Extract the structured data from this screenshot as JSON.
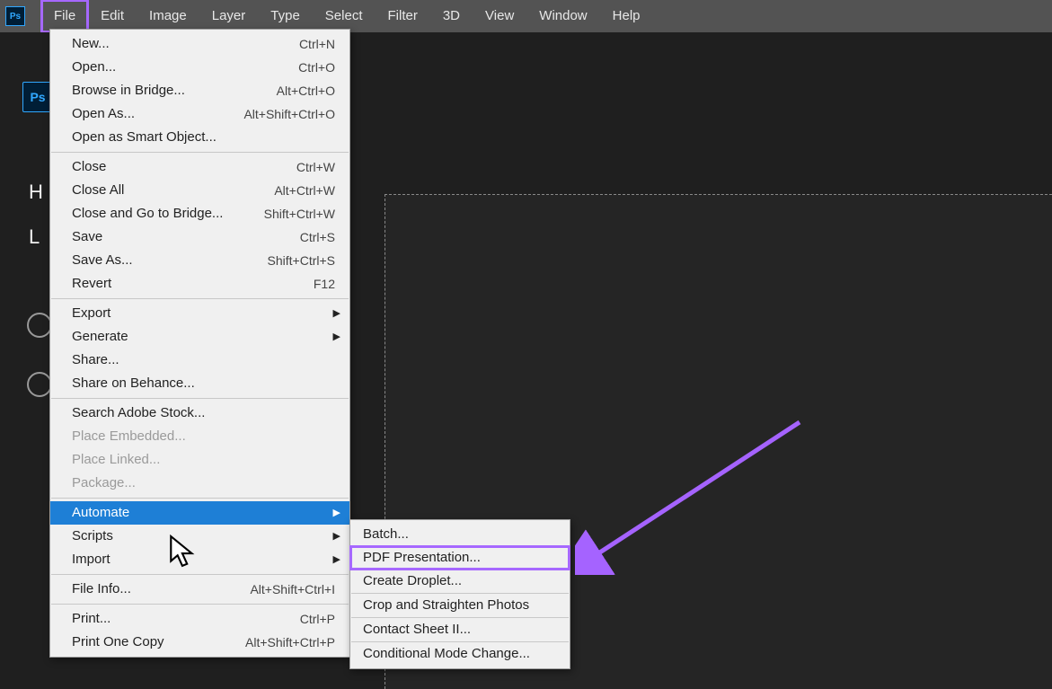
{
  "menubar": {
    "items": [
      {
        "label": "File",
        "active": true
      },
      {
        "label": "Edit"
      },
      {
        "label": "Image"
      },
      {
        "label": "Layer"
      },
      {
        "label": "Type"
      },
      {
        "label": "Select"
      },
      {
        "label": "Filter"
      },
      {
        "label": "3D"
      },
      {
        "label": "View"
      },
      {
        "label": "Window"
      },
      {
        "label": "Help"
      }
    ]
  },
  "app_icon": "Ps",
  "sidebar": {
    "h": "H",
    "l": "L"
  },
  "file_menu": {
    "groups": [
      [
        {
          "label": "New...",
          "shortcut": "Ctrl+N"
        },
        {
          "label": "Open...",
          "shortcut": "Ctrl+O"
        },
        {
          "label": "Browse in Bridge...",
          "shortcut": "Alt+Ctrl+O"
        },
        {
          "label": "Open As...",
          "shortcut": "Alt+Shift+Ctrl+O"
        },
        {
          "label": "Open as Smart Object..."
        }
      ],
      [
        {
          "label": "Close",
          "shortcut": "Ctrl+W"
        },
        {
          "label": "Close All",
          "shortcut": "Alt+Ctrl+W"
        },
        {
          "label": "Close and Go to Bridge...",
          "shortcut": "Shift+Ctrl+W"
        },
        {
          "label": "Save",
          "shortcut": "Ctrl+S"
        },
        {
          "label": "Save As...",
          "shortcut": "Shift+Ctrl+S"
        },
        {
          "label": "Revert",
          "shortcut": "F12"
        }
      ],
      [
        {
          "label": "Export",
          "submenu": true
        },
        {
          "label": "Generate",
          "submenu": true
        },
        {
          "label": "Share..."
        },
        {
          "label": "Share on Behance..."
        }
      ],
      [
        {
          "label": "Search Adobe Stock..."
        },
        {
          "label": "Place Embedded...",
          "disabled": true
        },
        {
          "label": "Place Linked...",
          "disabled": true
        },
        {
          "label": "Package...",
          "disabled": true
        }
      ],
      [
        {
          "label": "Automate",
          "submenu": true,
          "highlight": true
        },
        {
          "label": "Scripts",
          "submenu": true
        },
        {
          "label": "Import",
          "submenu": true
        }
      ],
      [
        {
          "label": "File Info...",
          "shortcut": "Alt+Shift+Ctrl+I"
        }
      ],
      [
        {
          "label": "Print...",
          "shortcut": "Ctrl+P"
        },
        {
          "label": "Print One Copy",
          "shortcut": "Alt+Shift+Ctrl+P"
        }
      ]
    ]
  },
  "automate_submenu": {
    "groups": [
      [
        {
          "label": "Batch..."
        },
        {
          "label": "PDF Presentation...",
          "boxed": true
        },
        {
          "label": "Create Droplet..."
        }
      ],
      [
        {
          "label": "Crop and Straighten Photos"
        }
      ],
      [
        {
          "label": "Contact Sheet II..."
        }
      ],
      [
        {
          "label": "Conditional Mode Change..."
        }
      ]
    ]
  }
}
